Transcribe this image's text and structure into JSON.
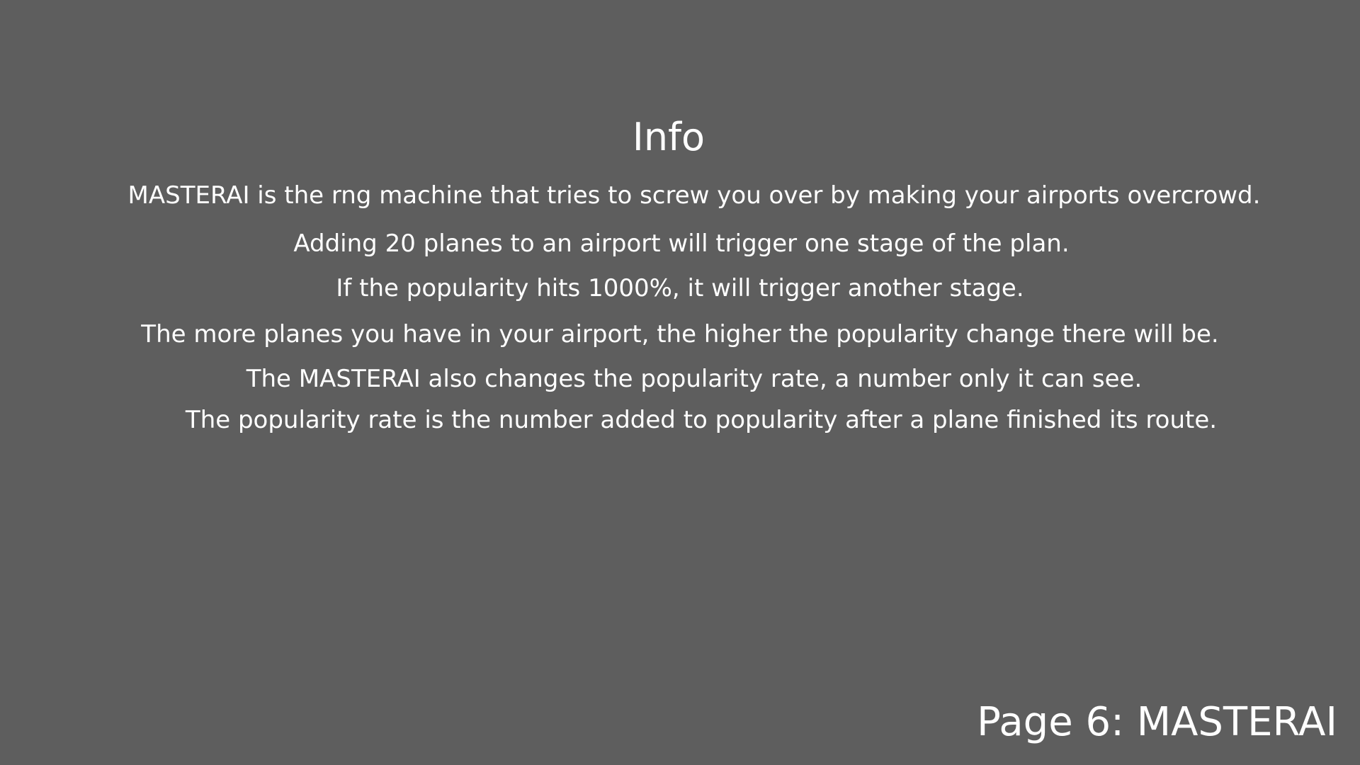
{
  "title": "Info",
  "lines": [
    "MASTERAI is the rng machine that tries to screw you over by making your airports overcrowd.",
    "Adding 20 planes to an airport will trigger one stage of the plan.",
    "If the popularity hits 1000%, it will trigger another stage.",
    "The more planes you have in your airport, the higher the popularity change there will be.",
    "The MASTERAI also changes the popularity rate, a number only it can see.",
    "The popularity rate is the number added to popularity after a plane finished its route."
  ],
  "page_label": "Page 6: MASTERAI"
}
